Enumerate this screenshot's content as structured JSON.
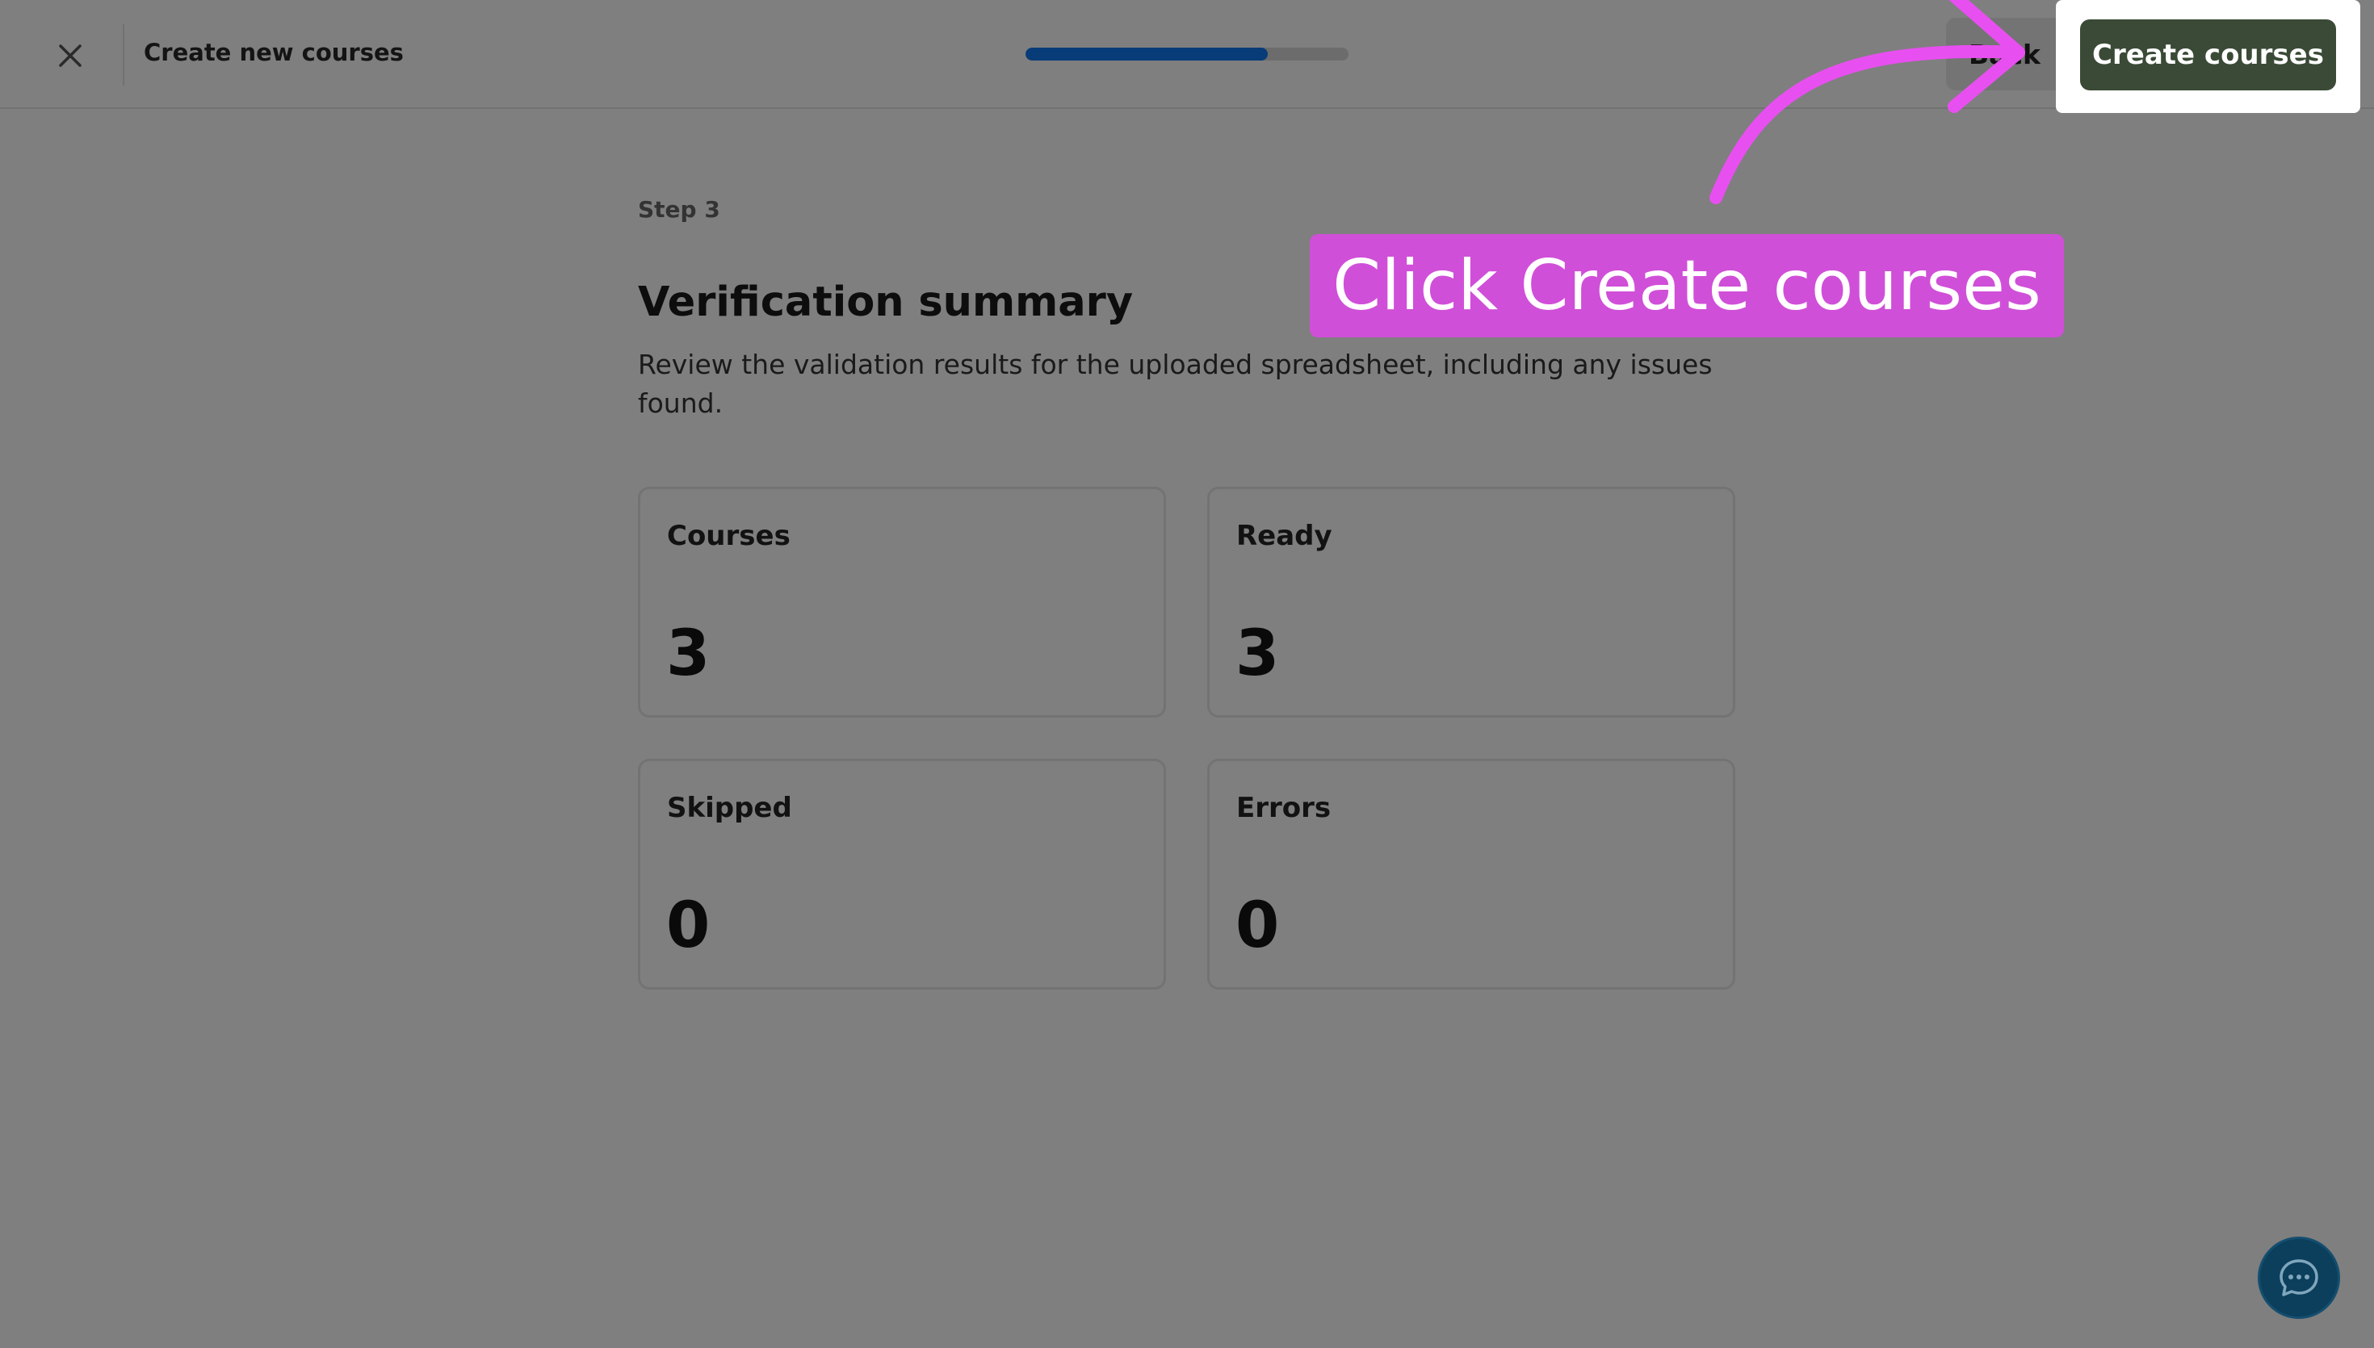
{
  "header": {
    "close_icon": "close-icon",
    "title": "Create new courses",
    "progress_percent": 75,
    "back_label": "Back",
    "create_label": "Create courses"
  },
  "main": {
    "step": "Step 3",
    "title": "Verification summary",
    "description": "Review the validation results for the uploaded spreadsheet, including any issues found."
  },
  "stats": [
    {
      "label": "Courses",
      "value": "3"
    },
    {
      "label": "Ready",
      "value": "3"
    },
    {
      "label": "Skipped",
      "value": "0"
    },
    {
      "label": "Errors",
      "value": "0"
    }
  ],
  "annotation": {
    "text": "Click Create courses",
    "color": "#d04fd8"
  },
  "chat": {
    "icon": "chat-bubble-icon"
  },
  "colors": {
    "primary_button": "#3a4a36",
    "progress_fill": "#073c78",
    "chat_button": "#0b3f5c"
  }
}
